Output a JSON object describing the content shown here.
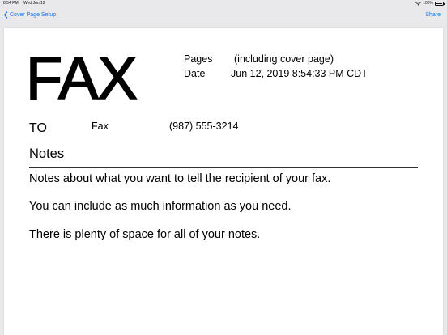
{
  "status_bar": {
    "time": "8:54 PM",
    "date": "Wed Jun 12",
    "battery": "100%",
    "battery_level": 1.0
  },
  "nav": {
    "back_label": "Cover Page Setup",
    "share_label": "Share"
  },
  "cover": {
    "title": "FAX",
    "pages_label": "Pages",
    "pages_value": "(including cover page)",
    "date_label": "Date",
    "date_value": "Jun 12, 2019 8:54:33 PM CDT",
    "to_label": "TO",
    "fax_label": "Fax",
    "fax_number": "(987) 555-3214",
    "notes_heading": "Notes",
    "notes": [
      "Notes about what you want to tell the recipient of your fax.",
      "You can include as much information as you need.",
      "There is plenty of space for all of your notes."
    ]
  },
  "colors": {
    "accent": "#1478f0",
    "background": "#e9e9ec",
    "sheet": "#ffffff"
  },
  "icons": {
    "back": "chevron-left-icon",
    "wifi": "wifi-icon",
    "battery": "battery-icon"
  }
}
